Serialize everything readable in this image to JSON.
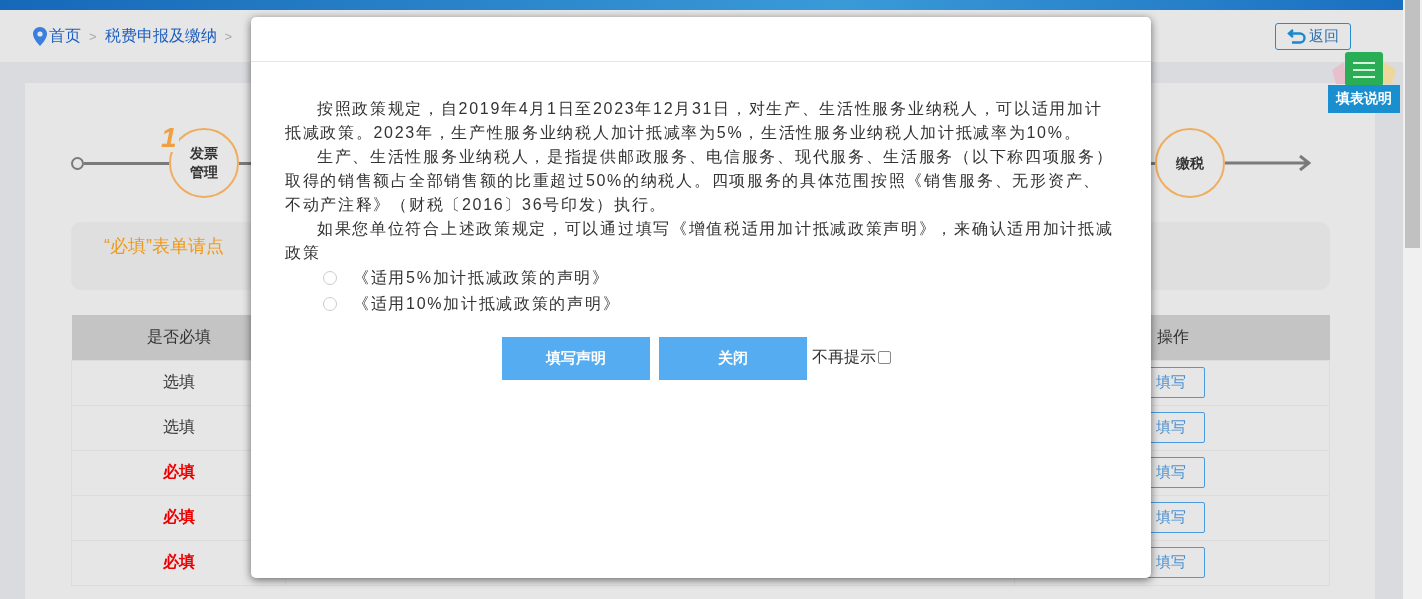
{
  "breadcrumb": [
    {
      "label": "首页",
      "kind": "home"
    },
    {
      "label": ">",
      "kind": "separator"
    },
    {
      "label": "税费申报及缴纳",
      "kind": "link"
    },
    {
      "label": ">",
      "kind": "separator"
    }
  ],
  "back_button": {
    "label": "返回"
  },
  "help_button": {
    "label": "填表说明"
  },
  "steps": [
    {
      "number": "1",
      "label": "发票管理"
    },
    {
      "label": "缴税"
    }
  ],
  "notice": {
    "text": "“必填”表单请点"
  },
  "table": {
    "columns": [
      "是否必填",
      "操作"
    ],
    "rows": [
      {
        "required": "选填",
        "kind": "optional",
        "action": "填写"
      },
      {
        "required": "选填",
        "kind": "optional",
        "action": "填写"
      },
      {
        "required": "必填",
        "kind": "required",
        "action": "填写"
      },
      {
        "required": "必填",
        "kind": "required",
        "action": "填写"
      },
      {
        "required": "必填",
        "kind": "required",
        "action": "填写"
      }
    ]
  },
  "dialog": {
    "paragraphs": [
      "按照政策规定，自2019年4月1日至2023年12月31日，对生产、生活性服务业纳税人，可以适用加计抵减政策。2023年，生产性服务业纳税人加计抵减率为5%，生活性服务业纳税人加计抵减率为10%。",
      "生产、生活性服务业纳税人，是指提供邮政服务、电信服务、现代服务、生活服务（以下称四项服务）取得的销售额占全部销售额的比重超过50%的纳税人。四项服务的具体范围按照《销售服务、无形资产、不动产注释》（财税〔2016〕36号印发）执行。",
      "如果您单位符合上述政策规定，可以通过填写《增值税适用加计抵减政策声明》，来确认适用加计抵减政策"
    ],
    "options": [
      {
        "label": "《适用5%加计抵减政策的声明》",
        "selected": false
      },
      {
        "label": "《适用10%加计抵减政策的声明》",
        "selected": false
      }
    ],
    "buttons": [
      "填写声明",
      "关闭"
    ],
    "dont_show_again": {
      "label": "不再提示",
      "checked": false
    }
  }
}
